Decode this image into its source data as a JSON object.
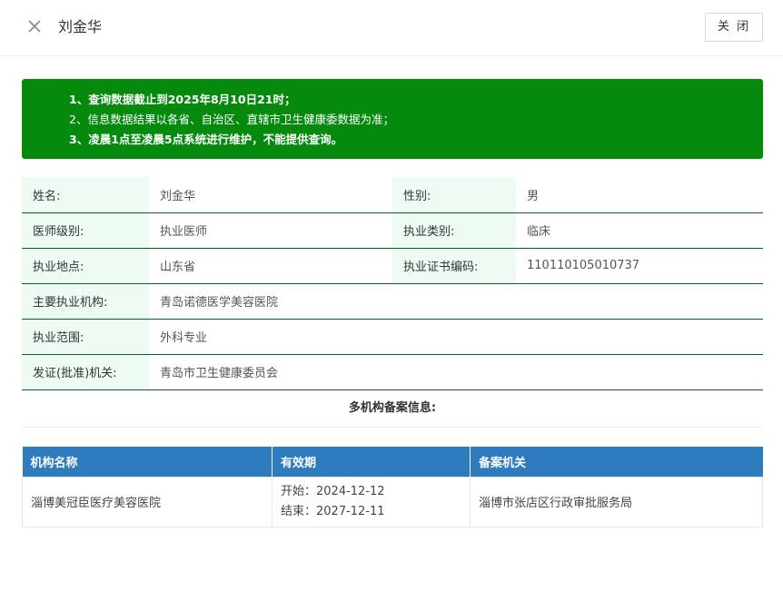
{
  "header": {
    "title": "刘金华",
    "close_label": "关 闭"
  },
  "notice": {
    "line1": "1、查询数据截止到2025年8月10日21时；",
    "line2": "2、信息数据结果以各省、自治区、直辖市卫生健康委数据为准；",
    "line3": "3、凌晨1点至凌晨5点系统进行维护，不能提供查询。",
    "bg_color": "#058a0e"
  },
  "info": {
    "name_label": "姓名:",
    "name_value": "刘金华",
    "gender_label": "性别:",
    "gender_value": "男",
    "level_label": "医师级别:",
    "level_value": "执业医师",
    "category_label": "执业类别:",
    "category_value": "临床",
    "location_label": "执业地点:",
    "location_value": "山东省",
    "cert_label": "执业证书编码:",
    "cert_value": "110110105010737",
    "org_label": "主要执业机构:",
    "org_value": "青岛诺德医学美容医院",
    "scope_label": "执业范围:",
    "scope_value": "外科专业",
    "issuer_label": "发证(批准)机关:",
    "issuer_value": "青岛市卫生健康委员会"
  },
  "multi": {
    "title": "多机构备案信息:",
    "columns": [
      "机构名称",
      "有效期",
      "备案机关"
    ],
    "rows": [
      {
        "org": "淄博美冠臣医疗美容医院",
        "start": "开始：2024-12-12",
        "end": "结束：2027-12-11",
        "authority": "淄博市张店区行政审批服务局"
      }
    ],
    "header_color": "#2e7bbd"
  }
}
